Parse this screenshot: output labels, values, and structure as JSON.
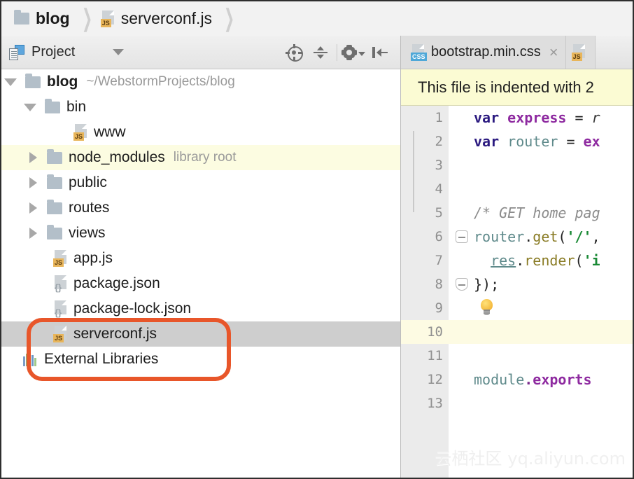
{
  "breadcrumb": {
    "items": [
      {
        "label": "blog",
        "icon": "folder-icon",
        "bold": true
      },
      {
        "label": "serverconf.js",
        "icon": "js-file-icon",
        "bold": false
      }
    ],
    "separator": "❯"
  },
  "project_panel": {
    "icon": "project-view-icon",
    "title": "Project",
    "dropdown_caret": "▾",
    "tools": [
      {
        "name": "scroll-from-source-icon",
        "label": ""
      },
      {
        "name": "collapse-all-icon",
        "label": ""
      },
      {
        "name": "settings-gear-icon",
        "label": ""
      },
      {
        "name": "hide-panel-icon",
        "label": ""
      }
    ]
  },
  "tree": {
    "items": [
      {
        "label": "blog",
        "note": "~/WebstormProjects/blog",
        "icon": "folder-icon",
        "state": "expanded",
        "depth": 0,
        "bold": true,
        "highlight": "none"
      },
      {
        "label": "bin",
        "note": "",
        "icon": "folder-icon",
        "state": "expanded",
        "depth": 1,
        "bold": false,
        "highlight": "none"
      },
      {
        "label": "www",
        "note": "",
        "icon": "js-file-icon",
        "state": "leaf",
        "depth": 2,
        "bold": false,
        "highlight": "none"
      },
      {
        "label": "node_modules",
        "note": "library root",
        "icon": "folder-icon",
        "state": "collapsed",
        "depth": 1,
        "bold": false,
        "highlight": "yellow"
      },
      {
        "label": "public",
        "note": "",
        "icon": "folder-icon",
        "state": "collapsed",
        "depth": 1,
        "bold": false,
        "highlight": "none"
      },
      {
        "label": "routes",
        "note": "",
        "icon": "folder-icon",
        "state": "collapsed",
        "depth": 1,
        "bold": false,
        "highlight": "none"
      },
      {
        "label": "views",
        "note": "",
        "icon": "folder-icon",
        "state": "collapsed",
        "depth": 1,
        "bold": false,
        "highlight": "none"
      },
      {
        "label": "app.js",
        "note": "",
        "icon": "js-file-icon",
        "state": "leaf",
        "depth": 1,
        "bold": false,
        "highlight": "none"
      },
      {
        "label": "package.json",
        "note": "",
        "icon": "json-file-icon",
        "state": "leaf",
        "depth": 1,
        "bold": false,
        "highlight": "none"
      },
      {
        "label": "package-lock.json",
        "note": "",
        "icon": "json-file-icon",
        "state": "leaf",
        "depth": 1,
        "bold": false,
        "highlight": "none"
      },
      {
        "label": "serverconf.js",
        "note": "",
        "icon": "js-file-icon",
        "state": "leaf",
        "depth": 1,
        "bold": false,
        "highlight": "selected"
      },
      {
        "label": "External Libraries",
        "note": "",
        "icon": "external-libraries-icon",
        "state": "leaf",
        "depth": 0,
        "bold": false,
        "highlight": "none"
      }
    ]
  },
  "annotation": {
    "color": "#e8562a",
    "targets": [
      "package-lock.json",
      "serverconf.js"
    ]
  },
  "editor": {
    "tabs": [
      {
        "label": "bootstrap.min.css",
        "icon": "css-file-icon",
        "close": "×",
        "active": true
      },
      {
        "label": "",
        "icon": "js-file-icon",
        "close": "",
        "active": false
      }
    ],
    "notification": "This file is indented with 2",
    "current_line": 10,
    "lines": [
      {
        "n": 1,
        "tokens": [
          {
            "t": "var ",
            "c": "kw"
          },
          {
            "t": "express",
            "c": "var"
          },
          {
            "t": " = ",
            "c": "pun"
          },
          {
            "t": "r",
            "c": "ital"
          }
        ]
      },
      {
        "n": 2,
        "tokens": [
          {
            "t": "var ",
            "c": "kw"
          },
          {
            "t": "router",
            "c": "obj"
          },
          {
            "t": " = ",
            "c": "pun"
          },
          {
            "t": "ex",
            "c": "var"
          }
        ]
      },
      {
        "n": 3,
        "tokens": []
      },
      {
        "n": 4,
        "tokens": []
      },
      {
        "n": 5,
        "tokens": [
          {
            "t": "/* GET home pag",
            "c": "cmt"
          }
        ]
      },
      {
        "n": 6,
        "tokens": [
          {
            "t": "router",
            "c": "obj"
          },
          {
            "t": ".",
            "c": "pun"
          },
          {
            "t": "get",
            "c": "fn"
          },
          {
            "t": "(",
            "c": "pun"
          },
          {
            "t": "'/'",
            "c": "str"
          },
          {
            "t": ",",
            "c": "pun"
          }
        ]
      },
      {
        "n": 7,
        "tokens": [
          {
            "t": "  ",
            "c": "pun"
          },
          {
            "t": "res",
            "c": "und"
          },
          {
            "t": ".",
            "c": "pun"
          },
          {
            "t": "render",
            "c": "fn"
          },
          {
            "t": "(",
            "c": "pun"
          },
          {
            "t": "'i",
            "c": "str"
          }
        ]
      },
      {
        "n": 8,
        "tokens": [
          {
            "t": "});",
            "c": "pun"
          }
        ]
      },
      {
        "n": 9,
        "tokens": []
      },
      {
        "n": 10,
        "tokens": []
      },
      {
        "n": 11,
        "tokens": []
      },
      {
        "n": 12,
        "tokens": [
          {
            "t": "module",
            "c": "obj"
          },
          {
            "t": ".",
            "c": "dot"
          },
          {
            "t": "exports",
            "c": "var"
          }
        ]
      },
      {
        "n": 13,
        "tokens": []
      }
    ]
  },
  "watermark": {
    "cn": "云栖社区",
    "url": "yq.aliyun.com"
  }
}
